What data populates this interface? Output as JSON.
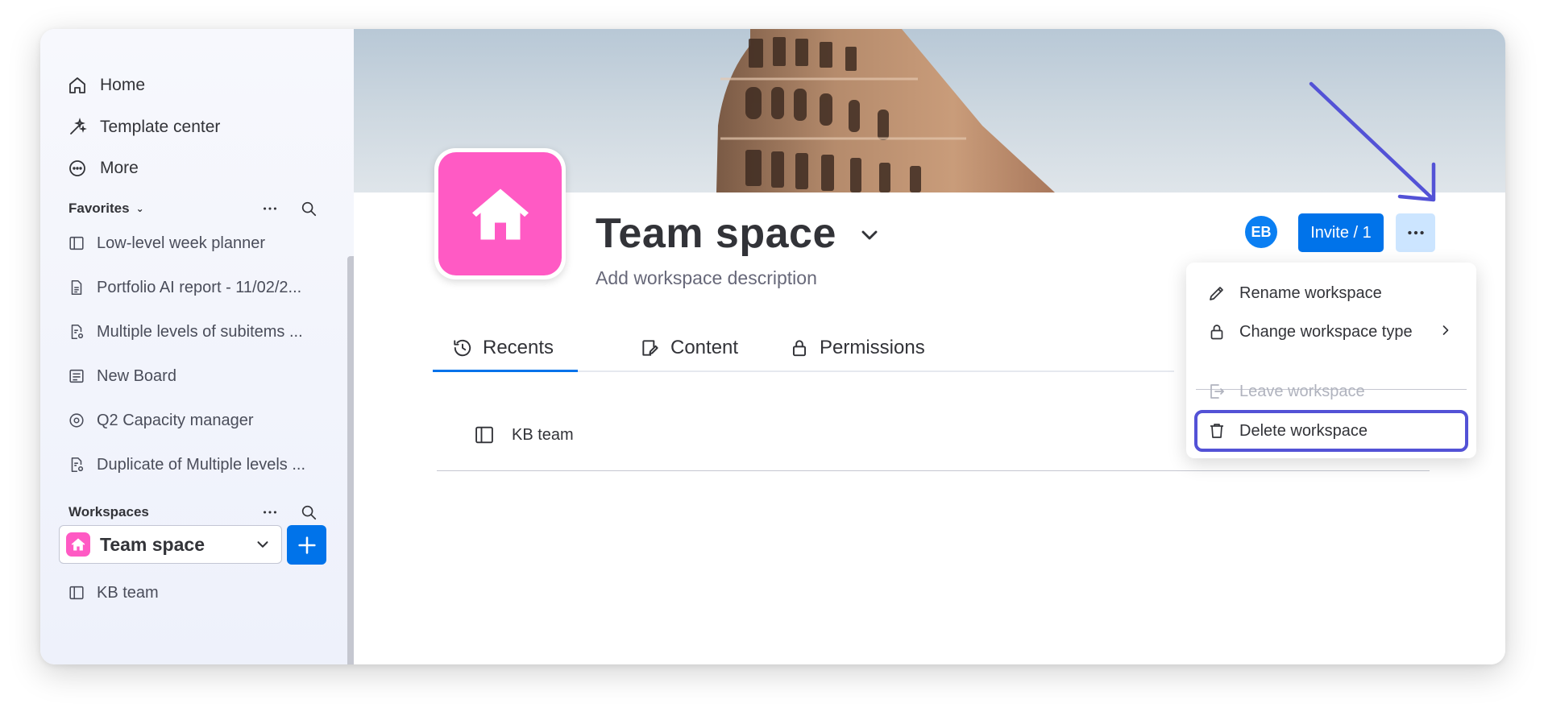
{
  "sidebar": {
    "nav": [
      {
        "label": "Home",
        "icon": "home-icon"
      },
      {
        "label": "Template center",
        "icon": "template-icon"
      },
      {
        "label": "More",
        "icon": "more-circle-icon"
      }
    ],
    "favorites": {
      "title": "Favorites",
      "items": [
        {
          "label": "Low-level week planner",
          "icon": "board-icon"
        },
        {
          "label": "Portfolio AI report - 11/02/2...",
          "icon": "doc-icon"
        },
        {
          "label": "Multiple levels of subitems ...",
          "icon": "doc-gear-icon"
        },
        {
          "label": "New Board",
          "icon": "board-list-icon"
        },
        {
          "label": "Q2 Capacity manager",
          "icon": "target-icon"
        },
        {
          "label": "Duplicate of Multiple levels ...",
          "icon": "doc-gear-icon"
        }
      ]
    },
    "workspaces": {
      "title": "Workspaces",
      "selected": "Team space",
      "items": [
        {
          "label": "KB team",
          "icon": "board-icon"
        }
      ]
    }
  },
  "workspace": {
    "title": "Team space",
    "description_placeholder": "Add workspace description",
    "avatar_initials": "EB",
    "invite_label": "Invite / 1"
  },
  "tabs": [
    {
      "label": "Recents",
      "icon": "history-icon",
      "active": true
    },
    {
      "label": "Content",
      "icon": "content-icon",
      "active": false
    },
    {
      "label": "Permissions",
      "icon": "lock-icon",
      "active": false
    }
  ],
  "recents": [
    {
      "label": "KB team",
      "icon": "board-icon"
    }
  ],
  "menu": {
    "items": [
      {
        "label": "Rename workspace",
        "icon": "pencil-icon",
        "disabled": false
      },
      {
        "label": "Change workspace type",
        "icon": "lock-icon",
        "disabled": false
      },
      {
        "label": "Leave workspace",
        "icon": "exit-icon",
        "disabled": true
      },
      {
        "label": "Delete workspace",
        "icon": "trash-icon",
        "disabled": false,
        "highlighted": true
      }
    ]
  },
  "colors": {
    "accent": "#0073ea",
    "workspace_icon": "#ff5ac4",
    "annotation": "#5352d6"
  }
}
